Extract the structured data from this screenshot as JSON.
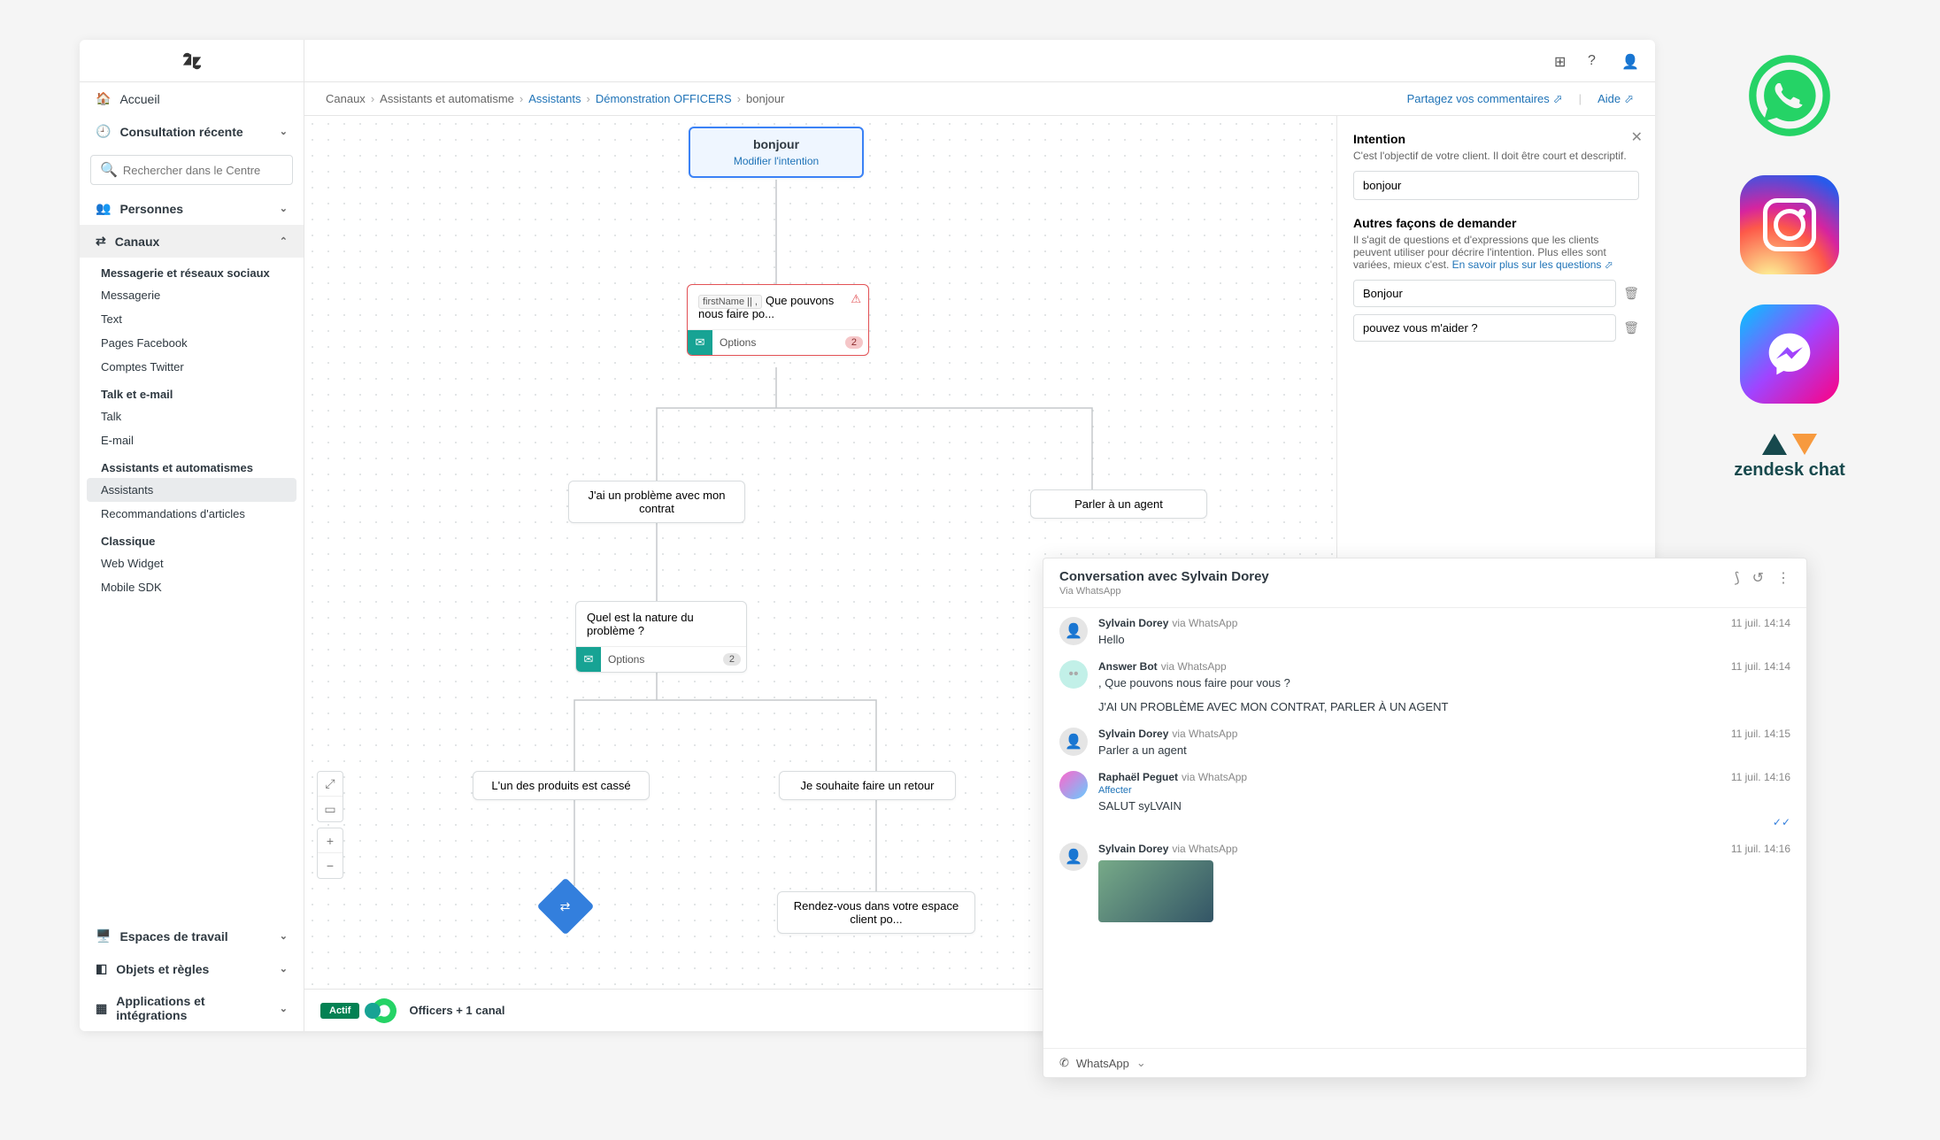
{
  "sidebar": {
    "search_placeholder": "Rechercher dans le Centre",
    "items": {
      "home": "Accueil",
      "recent": "Consultation récente",
      "people": "Personnes",
      "channels": "Canaux",
      "workspaces": "Espaces de travail",
      "objects": "Objets et règles",
      "apps": "Applications et intégrations"
    },
    "groups": {
      "messaging_heading": "Messagerie et réseaux sociaux",
      "messaging": "Messagerie",
      "text": "Text",
      "facebook": "Pages Facebook",
      "twitter": "Comptes Twitter",
      "talk_heading": "Talk et e-mail",
      "talk": "Talk",
      "email": "E-mail",
      "assistants_heading": "Assistants et automatismes",
      "assistants": "Assistants",
      "recommendations": "Recommandations d'articles",
      "classic_heading": "Classique",
      "web_widget": "Web Widget",
      "mobile_sdk": "Mobile SDK"
    }
  },
  "breadcrumb": {
    "canaux": "Canaux",
    "assistants_auto": "Assistants et automatisme",
    "assistants": "Assistants",
    "demo": "Démonstration OFFICERS",
    "bonjour": "bonjour",
    "share": "Partagez vos commentaires",
    "help": "Aide"
  },
  "flow": {
    "start_title": "bonjour",
    "start_edit": "Modifier l'intention",
    "msg_var": "firstName || ,",
    "msg_text": "Que pouvons nous faire po...",
    "options": "Options",
    "badge2": "2",
    "c1": "J'ai un problème avec mon contrat",
    "c2": "Parler à un agent",
    "q": "Quel est la nature du problème ?",
    "c3": "L'un des produits est cassé",
    "c4": "Je souhaite faire un retour",
    "rdv": "Rendez-vous dans votre espace client po..."
  },
  "bottom": {
    "actif": "Actif",
    "channel": "Officers + 1 canal"
  },
  "panel": {
    "intention": "Intention",
    "intention_desc": "C'est l'objectif de votre client. Il doit être court et descriptif.",
    "intention_value": "bonjour",
    "other_heading": "Autres façons de demander",
    "other_desc": "Il s'agit de questions et d'expressions que les clients peuvent utiliser pour décrire l'intention. Plus elles sont variées, mieux c'est. ",
    "other_link": "En savoir plus sur les questions",
    "q1": "Bonjour",
    "q2": "pouvez vous m'aider ?"
  },
  "chat": {
    "title": "Conversation avec Sylvain Dorey",
    "via": "Via WhatsApp",
    "msgs": [
      {
        "name": "Sylvain Dorey",
        "via": "via WhatsApp",
        "time": "11 juil. 14:14",
        "text": "Hello"
      },
      {
        "name": "Answer Bot",
        "via": "via WhatsApp",
        "time": "11 juil. 14:14",
        "text": ", Que pouvons nous faire pour vous ?",
        "text2": "J'AI UN PROBLÈME AVEC MON CONTRAT, PARLER À UN AGENT"
      },
      {
        "name": "Sylvain Dorey",
        "via": "via WhatsApp",
        "time": "11 juil. 14:15",
        "text": "Parler a un agent"
      },
      {
        "name": "Raphaël Peguet",
        "via": "via WhatsApp",
        "time": "11 juil. 14:16",
        "affect": "Affecter",
        "text": "SALUT syLVAIN"
      },
      {
        "name": "Sylvain Dorey",
        "via": "via WhatsApp",
        "time": "11 juil. 14:16"
      }
    ],
    "footer": "WhatsApp"
  },
  "ext": {
    "zendesk": "zendesk chat"
  }
}
